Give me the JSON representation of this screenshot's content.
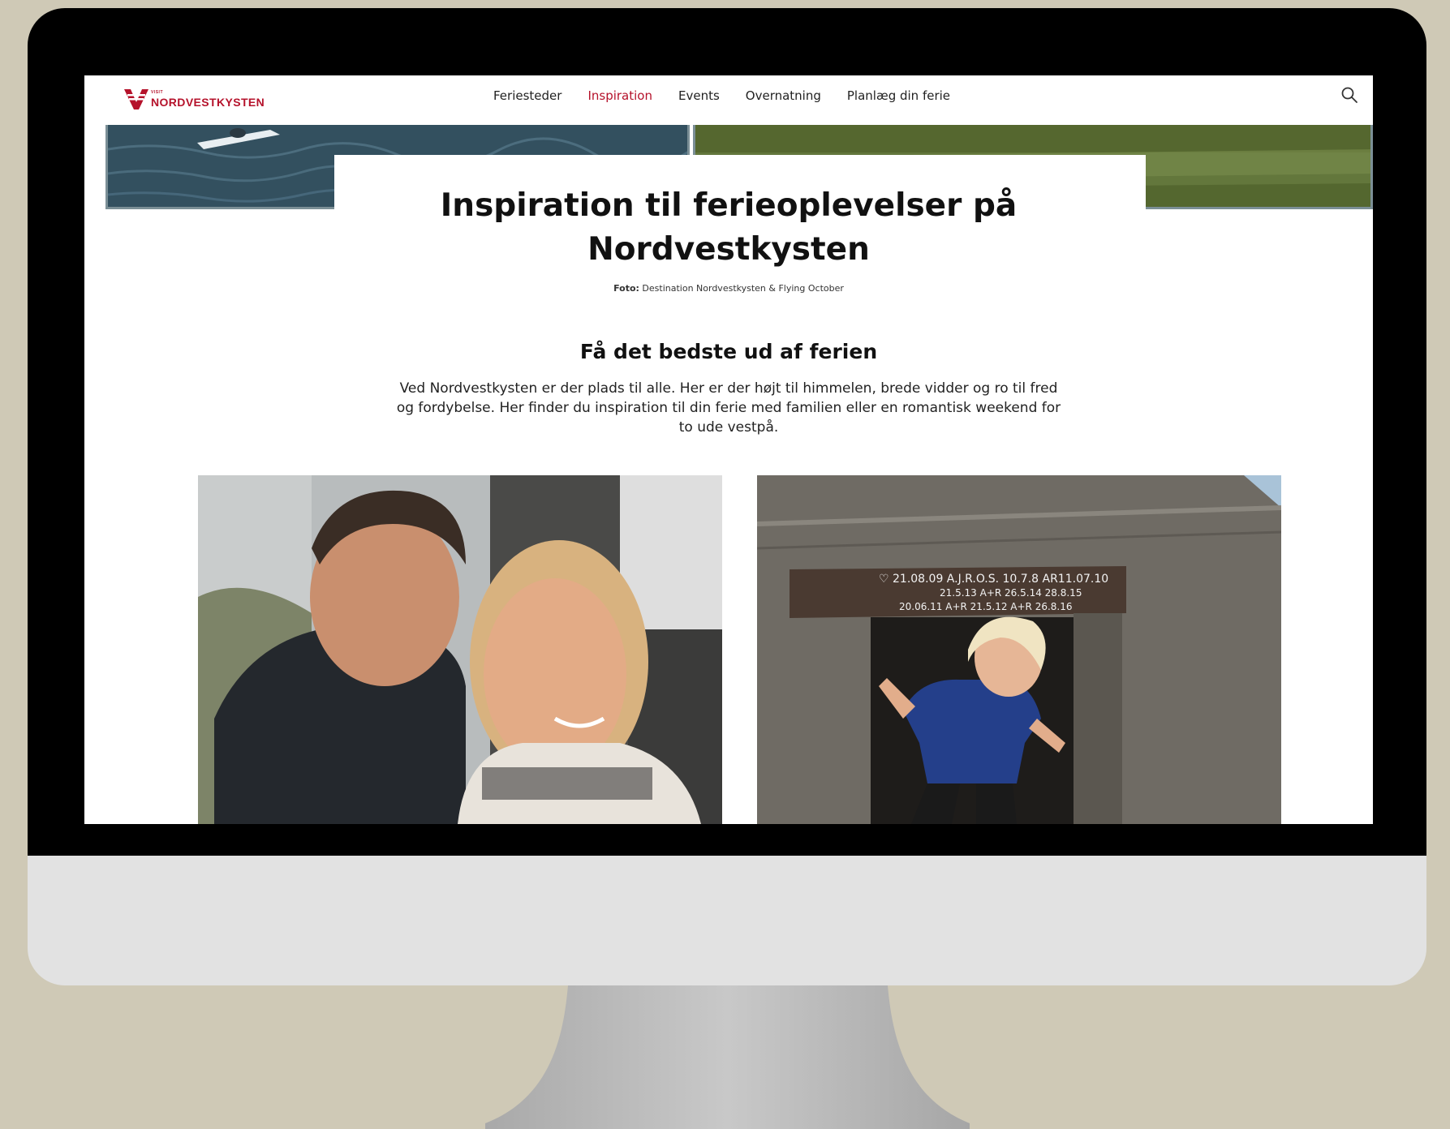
{
  "logo": {
    "small": "VISIT",
    "name": "NORDVESTKYSTEN",
    "brand_color": "#b5122b"
  },
  "nav": {
    "items": [
      {
        "label": "Feriesteder",
        "active": false
      },
      {
        "label": "Inspiration",
        "active": true
      },
      {
        "label": "Events",
        "active": false
      },
      {
        "label": "Overnatning",
        "active": false
      },
      {
        "label": "Planlæg din ferie",
        "active": false
      }
    ],
    "search_icon": "search-icon"
  },
  "hero": {
    "title_line1": "Inspiration til ferieoplevelser på",
    "title_line2": "Nordvestkysten",
    "credit_label": "Foto:",
    "credit_text": "Destination Nordvestkysten & Flying October"
  },
  "section": {
    "heading": "Få det bedste ud af ferien",
    "body": "Ved Nordvestkysten er der plads til alle. Her er der højt til himmelen, brede vidder og ro til fred og fordybelse. Her finder du inspiration til din ferie med familien eller en romantisk weekend for to ude vestpå."
  },
  "sign": {
    "line1": "♡ 21.08.09   A.J.R.O.S. 10.7.8 AR11.07.10",
    "line2": "21.5.13  A+R  26.5.14  28.8.15",
    "line3": "20.06.11 A+R   21.5.12  A+R  26.8.16"
  }
}
